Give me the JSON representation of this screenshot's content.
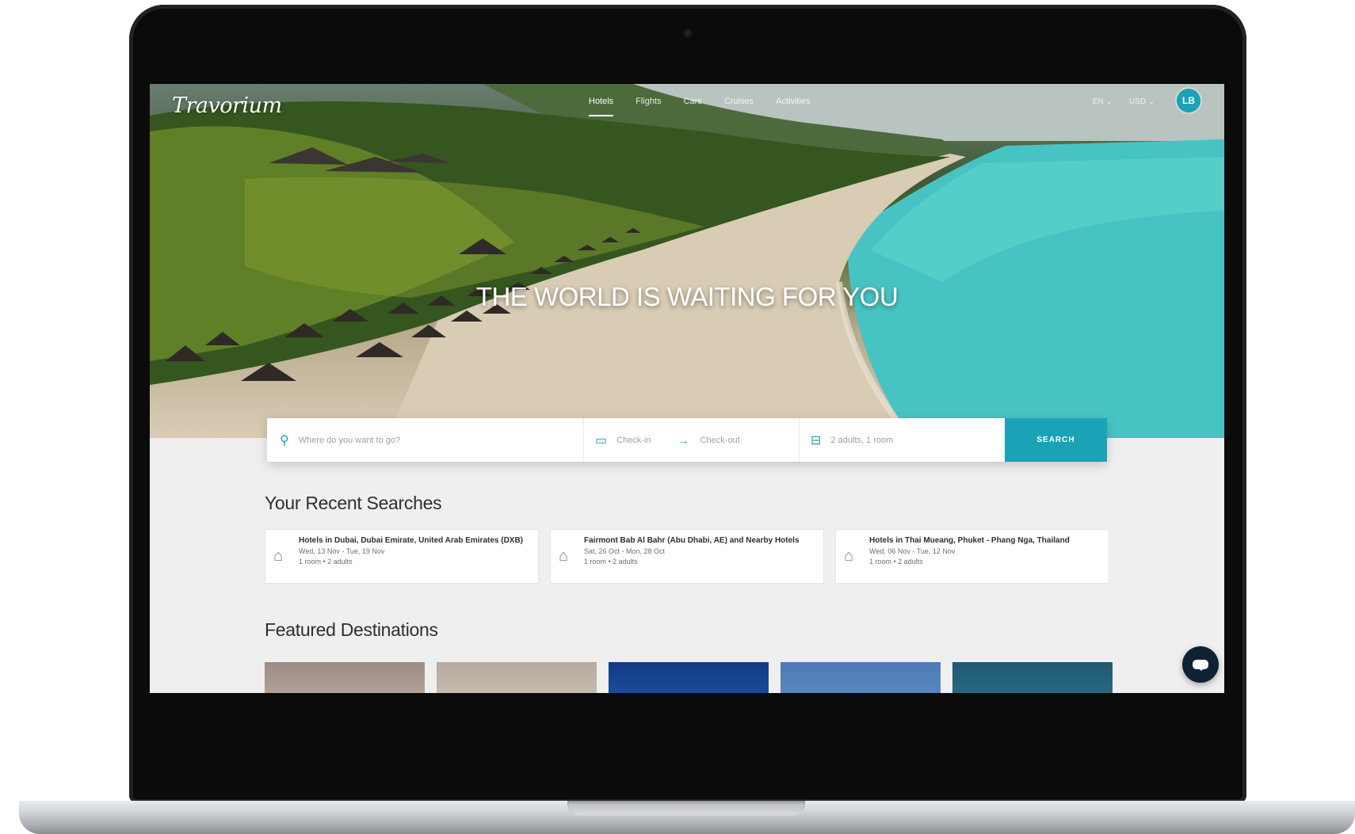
{
  "brand": {
    "logo": "Travorium",
    "accent": "#1aa3b6"
  },
  "nav": {
    "items": [
      {
        "label": "Hotels",
        "active": true
      },
      {
        "label": "Flights",
        "active": false
      },
      {
        "label": "Cars",
        "active": false
      },
      {
        "label": "Cruises",
        "active": false
      },
      {
        "label": "Activities",
        "active": false
      }
    ],
    "language": "EN ⌄",
    "currency": "USD ⌄",
    "avatar_initials": "LB"
  },
  "hero": {
    "title": "THE WORLD IS WAITING FOR YOU"
  },
  "search": {
    "destination_placeholder": "Where do you want to go?",
    "checkin_placeholder": "Check-in",
    "checkout_placeholder": "Check-out",
    "guests_value": "2 adults, 1 room",
    "button_label": "SEARCH"
  },
  "recent": {
    "title": "Your Recent Searches",
    "items": [
      {
        "title": "Hotels in Dubai, Dubai Emirate, United Arab Emirates (DXB)",
        "dates": "Wed, 13 Nov - Tue, 19 Nov",
        "guests": "1 room • 2 adults"
      },
      {
        "title": "Fairmont Bab Al Bahr (Abu Dhabi, AE) and Nearby Hotels",
        "dates": "Sat, 26 Oct - Mon, 28 Oct",
        "guests": "1 room • 2 adults"
      },
      {
        "title": "Hotels in Thai Mueang, Phuket - Phang Nga, Thailand",
        "dates": "Wed, 06 Nov - Tue, 12 Nov",
        "guests": "1 room • 2 adults"
      }
    ]
  },
  "featured": {
    "title": "Featured Destinations"
  },
  "icons": {
    "location": "map-pin-icon",
    "calendar": "calendar-icon",
    "arrow": "arrow-right-icon",
    "bed": "bed-icon",
    "building": "building-icon",
    "chat": "chat-icon"
  }
}
